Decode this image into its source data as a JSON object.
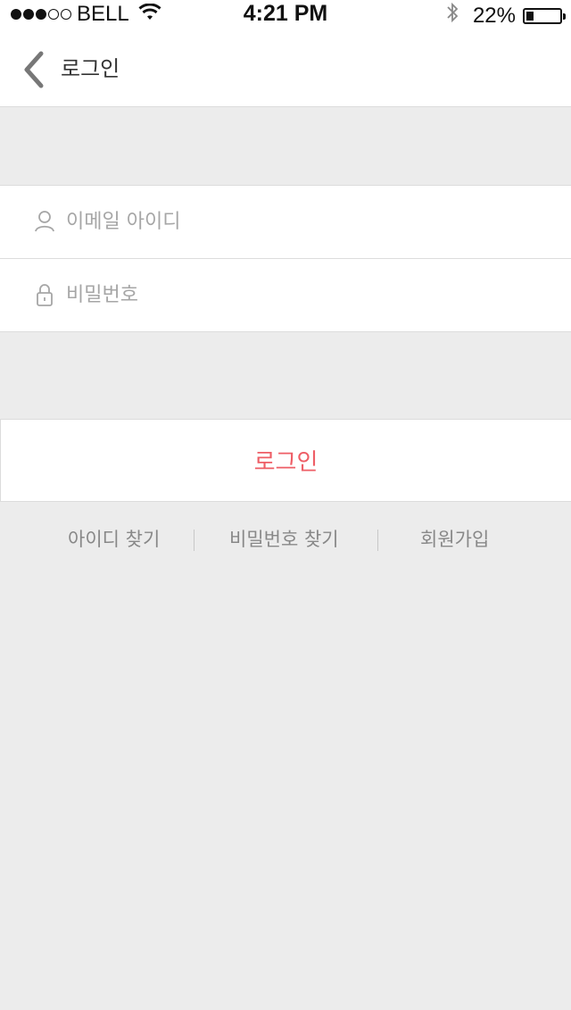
{
  "status_bar": {
    "carrier": "BELL",
    "time": "4:21 PM",
    "battery_percent_text": "22%",
    "battery_level": 0.22,
    "signal_bars_filled": 3,
    "signal_bars_total": 5
  },
  "nav": {
    "title": "로그인",
    "back_icon": "chevron-left-icon"
  },
  "form": {
    "email": {
      "placeholder": "이메일 아이디",
      "value": "",
      "icon": "user-icon"
    },
    "password": {
      "placeholder": "비밀번호",
      "value": "",
      "icon": "lock-icon"
    },
    "login_label": "로그인"
  },
  "links": {
    "find_id": "아이디 찾기",
    "find_password": "비밀번호 찾기",
    "signup": "회원가입"
  },
  "colors": {
    "accent": "#ee5e66",
    "background": "#ececec",
    "surface": "#ffffff"
  }
}
